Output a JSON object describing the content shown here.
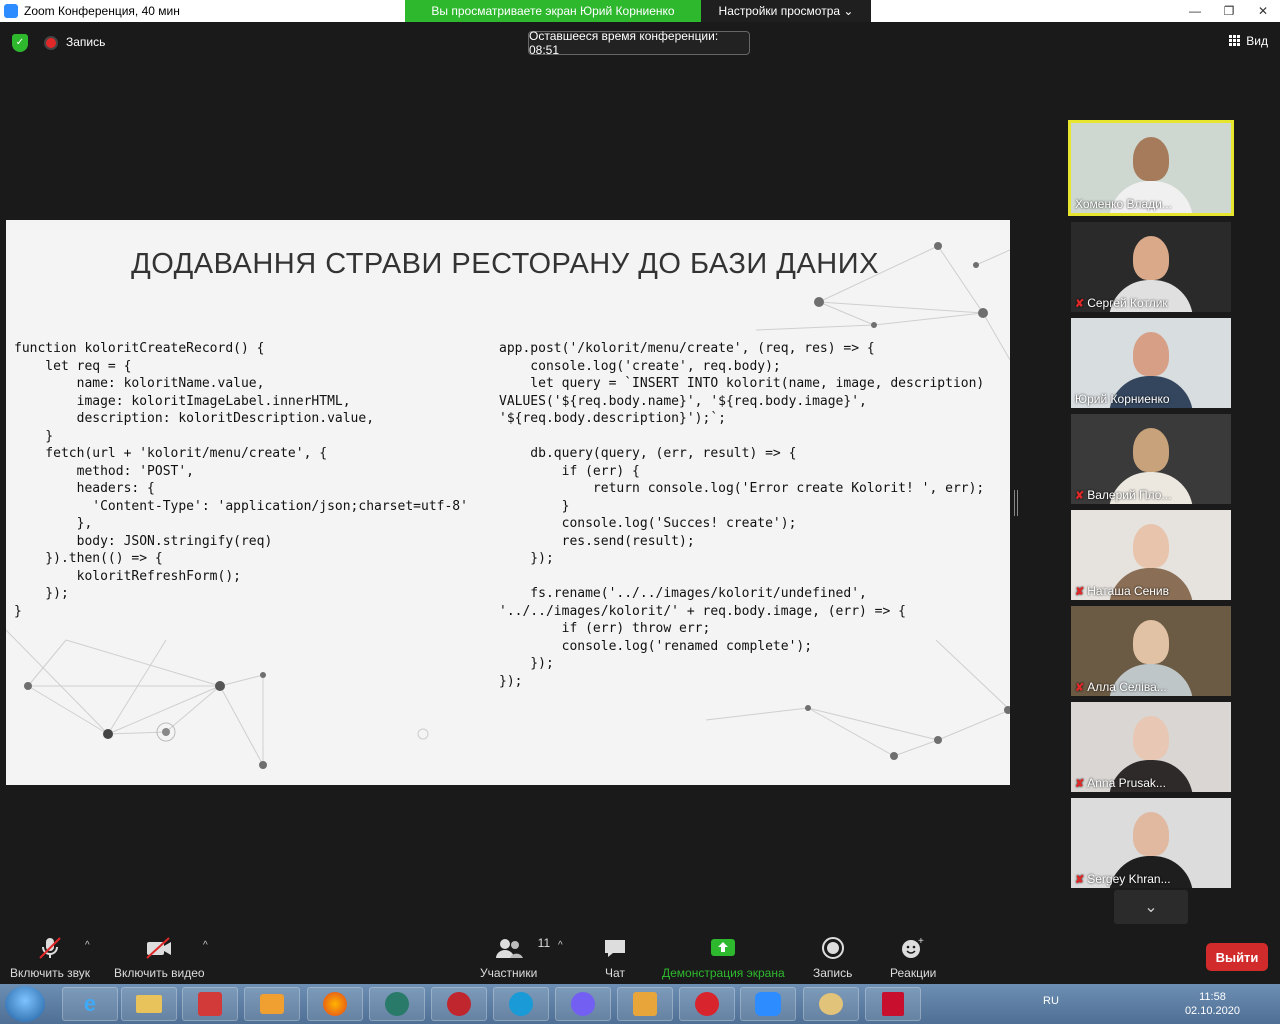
{
  "window": {
    "title": "Zoom Конференция, 40 мин",
    "share_banner": "Вы просматриваете экран Юрий Корниенко",
    "view_options": "Настройки просмотра ⌄",
    "controls": [
      "—",
      "❐",
      "✕"
    ]
  },
  "topbar": {
    "record_label": "Запись",
    "timer": "Оставшееся время конференции: 08:51",
    "view_label": "Вид"
  },
  "slide": {
    "title": "ДОДАВАННЯ СТРАВИ РЕСТОРАНУ ДО БАЗИ ДАНИХ",
    "code_left": "function koloritCreateRecord() {\n    let req = {\n        name: koloritName.value,\n        image: koloritImageLabel.innerHTML,\n        description: koloritDescription.value,\n    }\n    fetch(url + 'kolorit/menu/create', {\n        method: 'POST',\n        headers: {\n          'Content-Type': 'application/json;charset=utf-8'\n        },\n        body: JSON.stringify(req)\n    }).then(() => {\n        koloritRefreshForm();\n    });\n}",
    "code_right": "app.post('/kolorit/menu/create', (req, res) => {\n    console.log('create', req.body);\n    let query = `INSERT INTO kolorit(name, image, description)\nVALUES('${req.body.name}', '${req.body.image}',\n'${req.body.description}');`;\n\n    db.query(query, (err, result) => {\n        if (err) {\n            return console.log('Error create Kolorit! ', err);\n        }\n        console.log('Succes! create');\n        res.send(result);\n    });\n\n    fs.rename('../../images/kolorit/undefined',\n'../../images/kolorit/' + req.body.image, (err) => {\n        if (err) throw err;\n        console.log('renamed complete');\n    });\n});"
  },
  "participants": [
    {
      "name": "Хоменко Влади...",
      "muted": false,
      "active": true,
      "bg": "#cfd8d0",
      "skin": "#a67b5b",
      "shirt": "#f0f0f0"
    },
    {
      "name": "Сергей Котлик",
      "muted": true,
      "active": false,
      "bg": "#2a2a2a",
      "skin": "#d9a98a",
      "shirt": "#e0e0e0"
    },
    {
      "name": "Юрий Корниенко",
      "muted": false,
      "active": false,
      "bg": "#d8dde0",
      "skin": "#d79f86",
      "shirt": "#34465e"
    },
    {
      "name": "Валерий Пло...",
      "muted": true,
      "active": false,
      "bg": "#3a3a3a",
      "skin": "#c8a27a",
      "shirt": "#ece8e0"
    },
    {
      "name": "Наташа Сенив",
      "muted": true,
      "active": false,
      "bg": "#e6e2de",
      "skin": "#e8c4ac",
      "shirt": "#8a6e55"
    },
    {
      "name": "Алла Селіва...",
      "muted": true,
      "active": false,
      "bg": "#6b5a44",
      "skin": "#e2c2a4",
      "shirt": "#bfc6c8"
    },
    {
      "name": "Anna Prusak...",
      "muted": true,
      "active": false,
      "bg": "#d9d6d3",
      "skin": "#e8c8b4",
      "shirt": "#2f2a2a"
    },
    {
      "name": "Sergey Khran...",
      "muted": true,
      "active": false,
      "bg": "#dcdcdc",
      "skin": "#e0b9a0",
      "shirt": "#1e1e1e"
    }
  ],
  "toolbar": {
    "mute": "Включить звук",
    "video": "Включить видео",
    "participants": "Участники",
    "participants_count": "11",
    "chat": "Чат",
    "share": "Демонстрация экрана",
    "record": "Запись",
    "reactions": "Реакции",
    "leave": "Выйти"
  },
  "taskbar": {
    "lang": "RU",
    "time": "11:58",
    "date": "02.10.2020"
  },
  "colors": {
    "share_green": "#2eb82e",
    "leave_red": "#d12b2b",
    "active_border": "#e6e62e"
  }
}
